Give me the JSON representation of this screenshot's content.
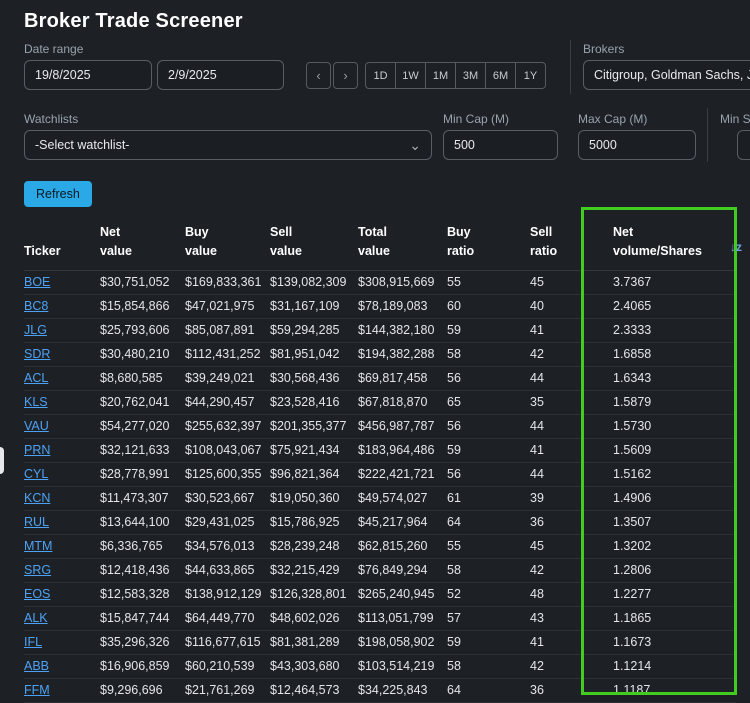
{
  "title": "Broker Trade Screener",
  "filters": {
    "date_range_label": "Date range",
    "date_from": "19/8/2025",
    "date_to": "2/9/2025",
    "prev": "‹",
    "next": "›",
    "periods": [
      "1D",
      "1W",
      "1M",
      "3M",
      "6M",
      "1Y"
    ],
    "brokers_label": "Brokers",
    "brokers_value": "Citigroup, Goldman Sachs, J.P",
    "watchlists_label": "Watchlists",
    "watchlist_selected": "-Select watchlist-",
    "min_cap_label": "Min Cap (M)",
    "min_cap_value": "500",
    "max_cap_label": "Max Cap (M)",
    "max_cap_value": "5000",
    "min_s_label": "Min S"
  },
  "refresh_label": "Refresh",
  "table": {
    "columns": [
      "Ticker",
      "Net\nvalue",
      "Buy\nvalue",
      "Sell\nvalue",
      "Total\nvalue",
      "Buy\nratio",
      "Sell\nratio",
      "Net\nvolume/Shares"
    ],
    "rows": [
      [
        "BOE",
        "$30,751,052",
        "$169,833,361",
        "$139,082,309",
        "$308,915,669",
        "55",
        "45",
        "3.7367"
      ],
      [
        "BC8",
        "$15,854,866",
        "$47,021,975",
        "$31,167,109",
        "$78,189,083",
        "60",
        "40",
        "2.4065"
      ],
      [
        "JLG",
        "$25,793,606",
        "$85,087,891",
        "$59,294,285",
        "$144,382,180",
        "59",
        "41",
        "2.3333"
      ],
      [
        "SDR",
        "$30,480,210",
        "$112,431,252",
        "$81,951,042",
        "$194,382,288",
        "58",
        "42",
        "1.6858"
      ],
      [
        "ACL",
        "$8,680,585",
        "$39,249,021",
        "$30,568,436",
        "$69,817,458",
        "56",
        "44",
        "1.6343"
      ],
      [
        "KLS",
        "$20,762,041",
        "$44,290,457",
        "$23,528,416",
        "$67,818,870",
        "65",
        "35",
        "1.5879"
      ],
      [
        "VAU",
        "$54,277,020",
        "$255,632,397",
        "$201,355,377",
        "$456,987,787",
        "56",
        "44",
        "1.5730"
      ],
      [
        "PRN",
        "$32,121,633",
        "$108,043,067",
        "$75,921,434",
        "$183,964,486",
        "59",
        "41",
        "1.5609"
      ],
      [
        "CYL",
        "$28,778,991",
        "$125,600,355",
        "$96,821,364",
        "$222,421,721",
        "56",
        "44",
        "1.5162"
      ],
      [
        "KCN",
        "$11,473,307",
        "$30,523,667",
        "$19,050,360",
        "$49,574,027",
        "61",
        "39",
        "1.4906"
      ],
      [
        "RUL",
        "$13,644,100",
        "$29,431,025",
        "$15,786,925",
        "$45,217,964",
        "64",
        "36",
        "1.3507"
      ],
      [
        "MTM",
        "$6,336,765",
        "$34,576,013",
        "$28,239,248",
        "$62,815,260",
        "55",
        "45",
        "1.3202"
      ],
      [
        "SRG",
        "$12,418,436",
        "$44,633,865",
        "$32,215,429",
        "$76,849,294",
        "58",
        "42",
        "1.2806"
      ],
      [
        "EOS",
        "$12,583,328",
        "$138,912,129",
        "$126,328,801",
        "$265,240,945",
        "52",
        "48",
        "1.2277"
      ],
      [
        "ALK",
        "$15,847,744",
        "$64,449,770",
        "$48,602,026",
        "$113,051,799",
        "57",
        "43",
        "1.1865"
      ],
      [
        "IFL",
        "$35,296,326",
        "$116,677,615",
        "$81,381,289",
        "$198,058,902",
        "59",
        "41",
        "1.1673"
      ],
      [
        "ABB",
        "$16,906,859",
        "$60,210,539",
        "$43,303,680",
        "$103,514,219",
        "58",
        "42",
        "1.1214"
      ],
      [
        "FFM",
        "$9,296,696",
        "$21,761,269",
        "$12,464,573",
        "$34,225,843",
        "64",
        "36",
        "1.1187"
      ]
    ]
  },
  "icons": {
    "chevron_down": "⌄",
    "sort_descending": "↓z"
  },
  "colors": {
    "accent_blue": "#2aa9e6",
    "link_blue": "#4da2f5",
    "annotation_green": "#42cc1f"
  }
}
